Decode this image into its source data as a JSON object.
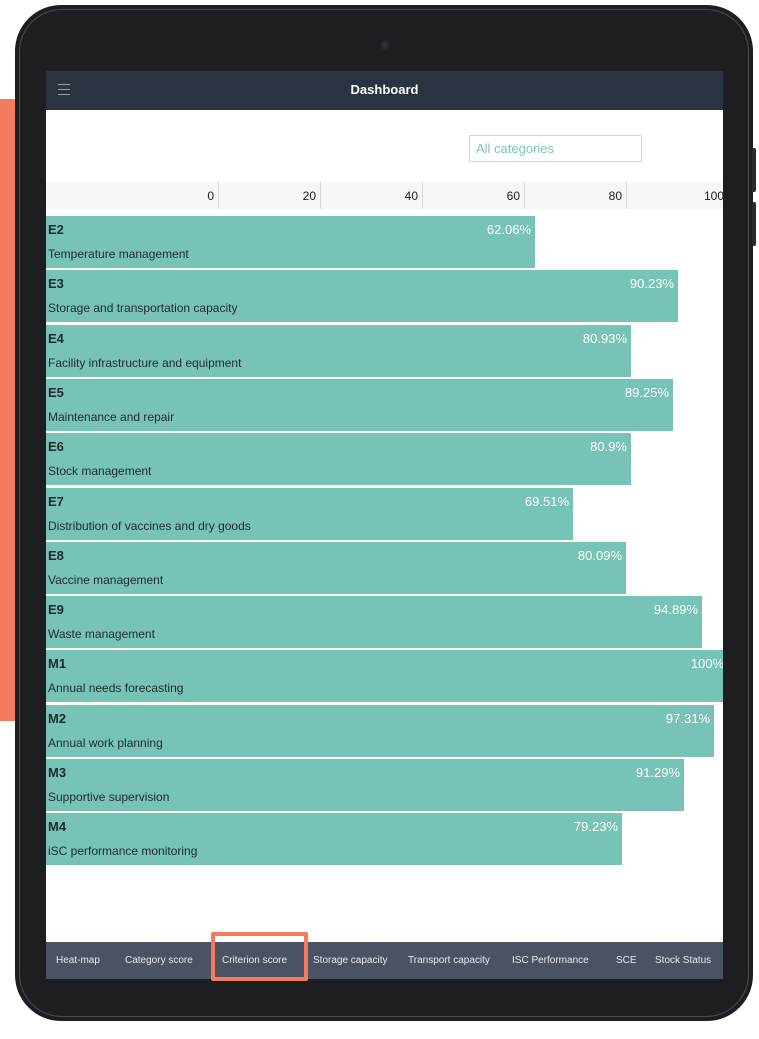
{
  "header": {
    "title": "Dashboard",
    "menu_icon": "hamburger-menu-icon"
  },
  "filter": {
    "value": "All categories"
  },
  "axis": {
    "ticks": [
      "0",
      "20",
      "40",
      "60",
      "80",
      "100"
    ],
    "range": [
      0,
      100
    ]
  },
  "chart_data": {
    "type": "bar",
    "orientation": "horizontal",
    "categories": [
      "E2",
      "E3",
      "E4",
      "E5",
      "E6",
      "E7",
      "E8",
      "E9",
      "M1",
      "M2",
      "M3",
      "M4"
    ],
    "values": [
      62.06,
      90.23,
      80.93,
      89.25,
      80.9,
      69.51,
      80.09,
      94.89,
      100,
      97.31,
      91.29,
      79.23
    ],
    "xlim": [
      0,
      100
    ],
    "bar_color": "#77c3b7"
  },
  "rows": [
    {
      "code": "E2",
      "name": "Temperature management",
      "value_label": "62.06%"
    },
    {
      "code": "E3",
      "name": "Storage and transportation capacity",
      "value_label": "90.23%"
    },
    {
      "code": "E4",
      "name": "Facility infrastructure and equipment",
      "value_label": "80.93%"
    },
    {
      "code": "E5",
      "name": "Maintenance and repair",
      "value_label": "89.25%"
    },
    {
      "code": "E6",
      "name": "Stock management",
      "value_label": "80.9%"
    },
    {
      "code": "E7",
      "name": "Distribution of vaccines and dry goods",
      "value_label": "69.51%"
    },
    {
      "code": "E8",
      "name": "Vaccine management",
      "value_label": "80.09%"
    },
    {
      "code": "E9",
      "name": "Waste management",
      "value_label": "94.89%"
    },
    {
      "code": "M1",
      "name": "Annual needs forecasting",
      "value_label": "100%"
    },
    {
      "code": "M2",
      "name": "Annual work planning",
      "value_label": "97.31%"
    },
    {
      "code": "M3",
      "name": "Supportive supervision",
      "value_label": "91.29%"
    },
    {
      "code": "M4",
      "name": "iSC performance monitoring",
      "value_label": "79.23%"
    }
  ],
  "tabs": [
    {
      "label": "Heat-map"
    },
    {
      "label": "Category score"
    },
    {
      "label": "Criterion score",
      "selected": true
    },
    {
      "label": "Storage capacity"
    },
    {
      "label": "Transport capacity"
    },
    {
      "label": "ISC Performance"
    },
    {
      "label": "SCE"
    },
    {
      "label": "Stock Status"
    }
  ],
  "colors": {
    "accent": "#f47b5d",
    "header_bg": "#2b3242",
    "tabbar_bg": "#4b5263",
    "bar": "#77c3b7",
    "filter_text": "#7cc3b8"
  }
}
